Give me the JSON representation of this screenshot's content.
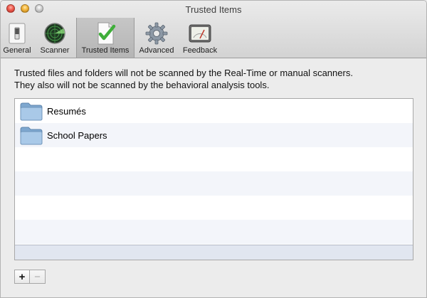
{
  "window": {
    "title": "Trusted Items"
  },
  "toolbar": {
    "items": [
      {
        "label": "General",
        "icon": "switch-icon",
        "selected": false
      },
      {
        "label": "Scanner",
        "icon": "radar-icon",
        "selected": false
      },
      {
        "label": "Trusted Items",
        "icon": "checkmark-document-icon",
        "selected": true
      },
      {
        "label": "Advanced",
        "icon": "gear-icon",
        "selected": false
      },
      {
        "label": "Feedback",
        "icon": "gauge-icon",
        "selected": false
      }
    ]
  },
  "description": {
    "line1": "Trusted files and folders will not be scanned by the Real-Time or manual scanners.",
    "line2": "They also will not be scanned by the behavioral analysis tools."
  },
  "trusted_list": {
    "items": [
      {
        "name": "Resumés",
        "icon": "folder-icon"
      },
      {
        "name": "School Papers",
        "icon": "folder-icon"
      }
    ]
  },
  "buttons": {
    "add_label": "+",
    "remove_label": "−"
  }
}
